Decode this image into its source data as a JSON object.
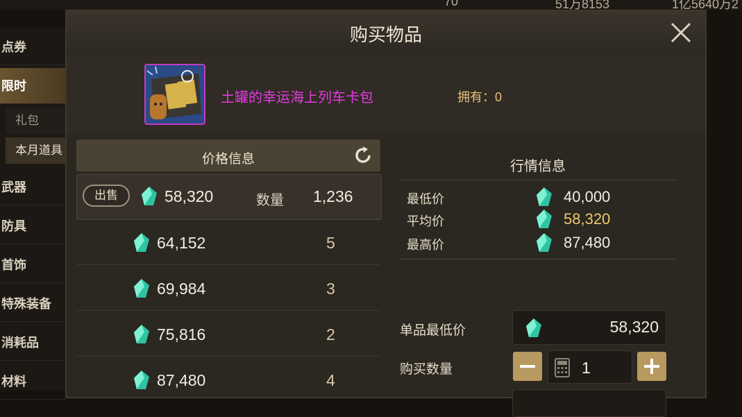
{
  "background": {
    "top_values": [
      "70",
      "51万8153",
      "1亿5640万2"
    ],
    "sidebar_items": [
      "点券",
      "限时",
      "礼包",
      "本月道具",
      "武器",
      "防具",
      "首饰",
      "特殊装备",
      "消耗品",
      "材料"
    ]
  },
  "dialog": {
    "title": "购买物品",
    "item_name": "土罐的幸运海上列车卡包",
    "own_label": "拥有：0"
  },
  "price_info": {
    "header": "价格信息",
    "sell_label": "出售",
    "qty_label": "数量",
    "rows": [
      {
        "price": "58,320",
        "qty": "1,236"
      },
      {
        "price": "64,152",
        "qty": "5"
      },
      {
        "price": "69,984",
        "qty": "3"
      },
      {
        "price": "75,816",
        "qty": "2"
      },
      {
        "price": "87,480",
        "qty": "4"
      }
    ]
  },
  "market_info": {
    "header": "行情信息",
    "lowest_label": "最低价",
    "lowest": "40,000",
    "average_label": "平均价",
    "average": "58,320",
    "highest_label": "最高价",
    "highest": "87,480"
  },
  "purchase": {
    "unit_price_label": "单品最低价",
    "unit_price": "58,320",
    "quantity_label": "购买数量",
    "quantity": "1"
  },
  "colors": {
    "item_name": "#e43be3",
    "average": "#f0c96a",
    "button": "#b89a60"
  }
}
